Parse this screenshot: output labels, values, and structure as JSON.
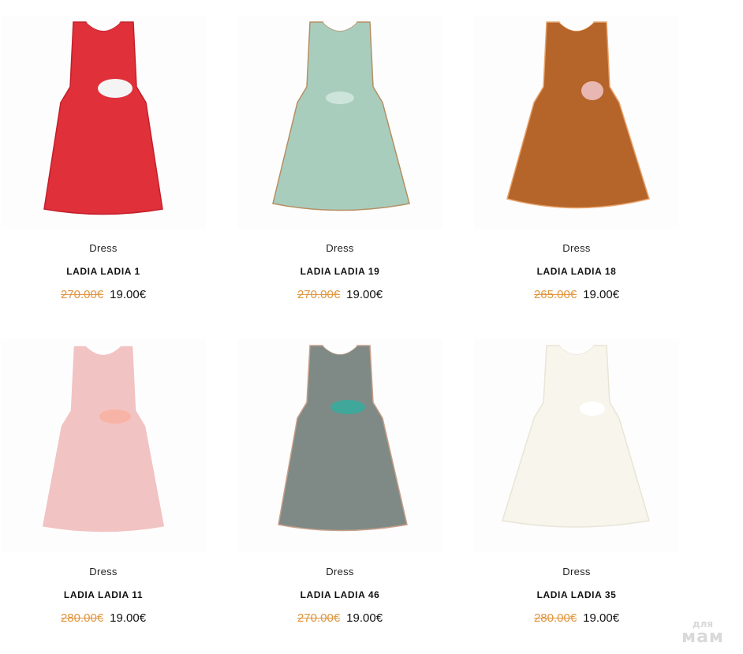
{
  "products": [
    {
      "category": "Dress",
      "name": "LADIA LADIA 1",
      "old_price": "270.00€",
      "price": "19.00€",
      "color": "#e0303a",
      "pattern": "#c21f2a",
      "accent": "#f4f4f4"
    },
    {
      "category": "Dress",
      "name": "LADIA LADIA 19",
      "old_price": "270.00€",
      "price": "19.00€",
      "color": "#a9cdbd",
      "pattern": "#b58f63",
      "accent": "#cde4da"
    },
    {
      "category": "Dress",
      "name": "LADIA LADIA 18",
      "old_price": "265.00€",
      "price": "19.00€",
      "color": "#b5642a",
      "pattern": "#e7a26a",
      "accent": "#e8b7b2"
    },
    {
      "category": "Dress",
      "name": "LADIA LADIA 11",
      "old_price": "280.00€",
      "price": "19.00€",
      "color": "#f2c3c3",
      "pattern": "#ffffff",
      "accent": "#f7b4a6"
    },
    {
      "category": "Dress",
      "name": "LADIA LADIA 46",
      "old_price": "270.00€",
      "price": "19.00€",
      "color": "#7f8a86",
      "pattern": "#c7a08a",
      "accent": "#3fa89a"
    },
    {
      "category": "Dress",
      "name": "LADIA LADIA 35",
      "old_price": "280.00€",
      "price": "19.00€",
      "color": "#f7f5ec",
      "pattern": "#e9e5d6",
      "accent": "#ffffff"
    }
  ],
  "watermark": {
    "top": "для",
    "bottom": "мам"
  }
}
